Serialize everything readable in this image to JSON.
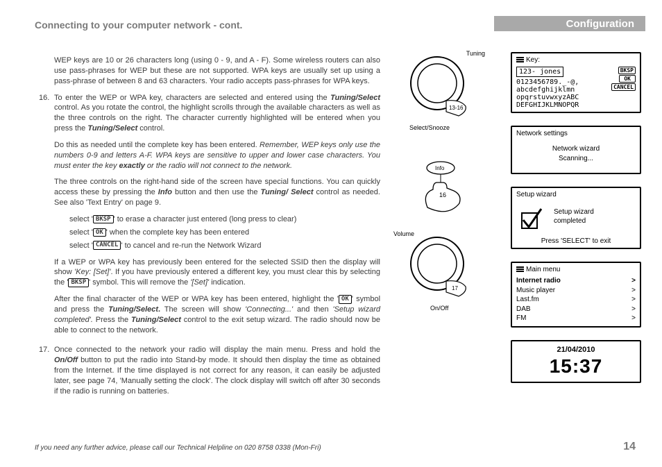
{
  "header": {
    "left": "Connecting to your computer network - cont.",
    "right": "Configuration"
  },
  "para_intro": "WEP keys are 10 or 26 characters long (using 0 - 9, and A - F). Some wireless routers can also use pass-phrases for WEP but these are not supported. WPA keys are usually set up using a pass-phrase of between 8 and 63 characters. Your radio accepts pass-phrases for WPA keys.",
  "step16": {
    "num": "16.",
    "a1": "To enter the WEP or WPA key, characters are selected and entered using the ",
    "b1": "Tuning/Select",
    "a2": " control. As you rotate the control, the highlight scrolls through the available characters as well as the three controls on the right. The character currently highlighted will be entered when you press the ",
    "b2": "Tuning/Select",
    "a3": " control."
  },
  "step16b": {
    "a1": "Do this as needed until the complete key has been entered. ",
    "i1": "Remember, WEP keys only use the numbers 0-9 and letters A-F. WPA keys are sensitive to upper and lower case characters. You must enter the key ",
    "b1": "exactly",
    "i2": " or the radio will not connect to the network."
  },
  "step16c": {
    "a1": "The three controls on the right-hand side of the screen have special functions. You can quickly access these by pressing the ",
    "b1": "Info",
    "a2": " button and then use the ",
    "b2": "Tuning/ Select",
    "a3": " control as needed. See also 'Text Entry' on page 9."
  },
  "selects": {
    "pre": "select '",
    "k1": "BKSP",
    "t1": "' to erase a character just entered (long press to clear)",
    "k2": "OK",
    "t2": "' when the complete key has been entered",
    "k3": "CANCEL",
    "t3": "' to cancel and re-run the Network Wizard"
  },
  "step16d": {
    "a1": "If a WEP or WPA key has previously been entered for the selected SSID then the display will show ",
    "i1": "'Key: [Set]'",
    "a2": ". If you have previously entered a different key, you must clear this by selecting the '",
    "k1": "BKSP",
    "a3": "' symbol. This will remove the ",
    "i2": "'[Set]'",
    "a4": " indication."
  },
  "step16e": {
    "a1": "After the final character of the WEP or WPA key has been entered, highlight the '",
    "k1": "OK",
    "a2": "' symbol and press the ",
    "b1": "Tuning/Select",
    "a3": " control",
    "b1b": ".",
    "a3b": " The screen will show ",
    "i1": "'Connecting...'",
    "a4": " and then ",
    "i2": "'Setup wizard completed'.",
    "a5": " Press the ",
    "b2": "Tuning/Select",
    "a6": " control to the exit setup wizard. The radio should now be able to connect to the network."
  },
  "step17": {
    "num": "17.",
    "a1": "Once connected to the network your radio will display the main menu. Press and hold the ",
    "b1": "On/Off",
    "a2": " button to put the radio into Stand-by mode. It should then display the time as obtained from the Internet. If the time displayed is not correct for any reason, it can easily be adjusted later, see page 74, 'Manually setting the clock'. The clock display will switch off after 30 seconds if the radio is running on batteries."
  },
  "diagrams": {
    "d1_top": "Tuning",
    "d1_bottom": "Select/Snooze",
    "d1_num": "13-16",
    "d2_label": "Info",
    "d2_num": "16",
    "d3_top": "Volume",
    "d3_bottom": "On/Off",
    "d3_num": "17"
  },
  "screens": {
    "key": {
      "title": "Key:",
      "input": "123- jones",
      "row1": "0123456789._-@,",
      "row2": " abcdefghijklmn",
      "row3": "opqrstuvwxyzABC",
      "row4": "DEFGHIJKLMNOPQR",
      "b1": "BKSP",
      "b2": "OK",
      "b3": "CANCEL"
    },
    "network": {
      "title": "Network settings",
      "line1": "Network wizard",
      "line2": "Scanning..."
    },
    "setup": {
      "title": "Setup wizard",
      "line1": "Setup wizard",
      "line2": "completed",
      "foot": "Press 'SELECT' to exit"
    },
    "menu": {
      "title": "Main menu",
      "items": [
        "Internet radio",
        "Music player",
        "Last.fm",
        "DAB",
        "FM"
      ]
    },
    "clock": {
      "date": "21/04/2010",
      "time": "15:37"
    }
  },
  "footer": "If you need any further advice, please call our Technical Helpline on 020 8758 0338 (Mon-Fri)",
  "page_num": "14"
}
